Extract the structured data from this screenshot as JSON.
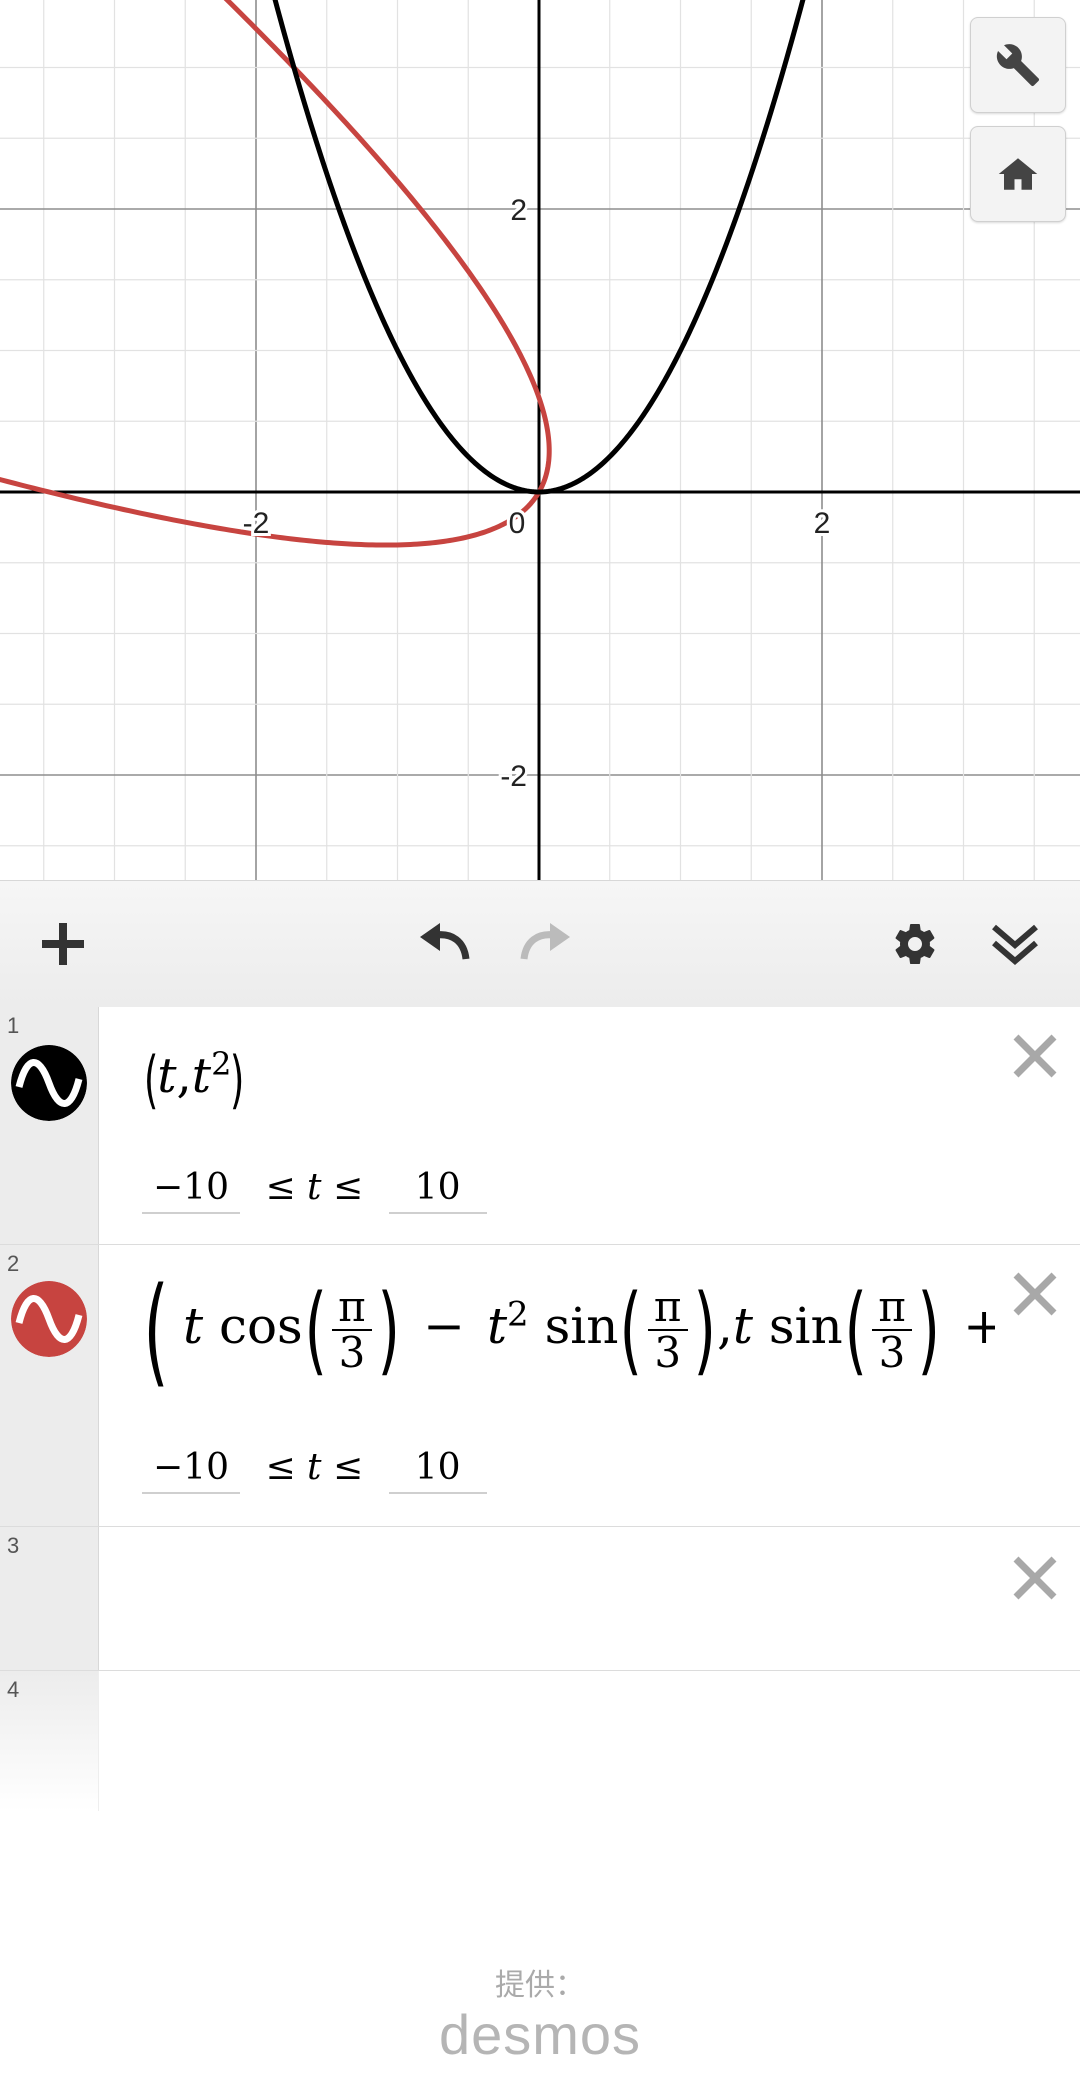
{
  "graph": {
    "x_tick_labels": [
      "-2",
      "0",
      "2"
    ],
    "y_tick_labels": [
      "2",
      "-2"
    ],
    "curve_colors": {
      "expr1": "#000000",
      "expr2": "#c74440"
    }
  },
  "tools": {
    "wrench_icon": "wrench-icon",
    "home_icon": "home-icon"
  },
  "toolbar": {
    "add_icon": "plus-icon",
    "undo_icon": "undo-icon",
    "redo_icon": "redo-icon",
    "settings_icon": "gear-icon",
    "collapse_icon": "double-chevron-down-icon"
  },
  "expressions": [
    {
      "index": "1",
      "t": "t",
      "comma": ",",
      "exp": "2",
      "domain_min": "−10",
      "domain_max": "10",
      "domain_mid": "≤ t ≤"
    },
    {
      "index": "2",
      "t": "t",
      "cos": "cos",
      "sin": "sin",
      "pi": "π",
      "three": "3",
      "minus": "−",
      "exp": "2",
      "comma": ",",
      "plus": "+",
      "domain_min": "−10",
      "domain_max": "10",
      "domain_mid": "≤ t ≤"
    },
    {
      "index": "3"
    },
    {
      "index": "4"
    }
  ],
  "footer": {
    "provided_by": "提供：",
    "brand": "desmos"
  }
}
